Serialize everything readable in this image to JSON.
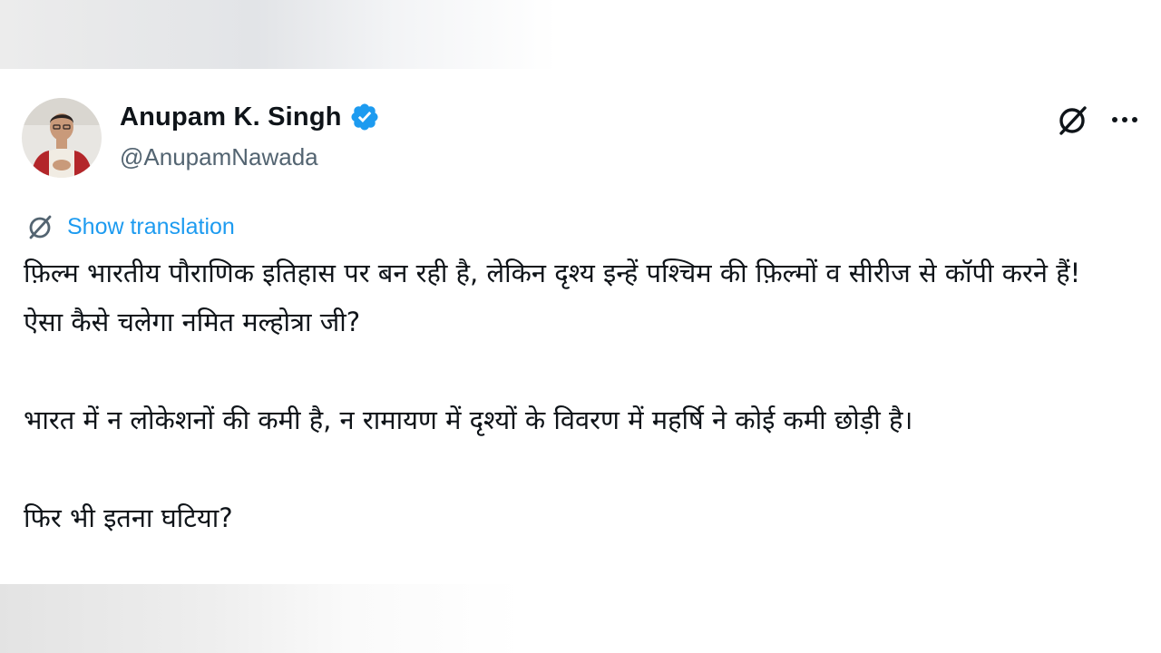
{
  "tweet": {
    "author": {
      "display_name": "Anupam K. Singh",
      "handle": "@AnupamNawada",
      "verified": true,
      "avatar": "avatar-photo"
    },
    "actions": {
      "grok_icon": "grok-icon",
      "more_icon": "more-icon"
    },
    "translate": {
      "label": "Show translation",
      "icon": "translate-icon"
    },
    "body": {
      "paragraphs": [
        "फ़िल्म भारतीय पौराणिक इतिहास पर बन रही है, लेकिन दृश्य इन्हें पश्चिम की फ़िल्मों व सीरीज से कॉपी करने हैं! ऐसा कैसे चलेगा नमित मल्होत्रा जी?",
        "भारत में न लोकेशनों की कमी है, न रामायण में दृश्यों के विवरण में महर्षि ने कोई कमी छोड़ी है।",
        "फिर भी इतना घटिया?"
      ]
    }
  },
  "colors": {
    "text_primary": "#0f1419",
    "text_secondary": "#536471",
    "accent": "#1d9bf0"
  }
}
